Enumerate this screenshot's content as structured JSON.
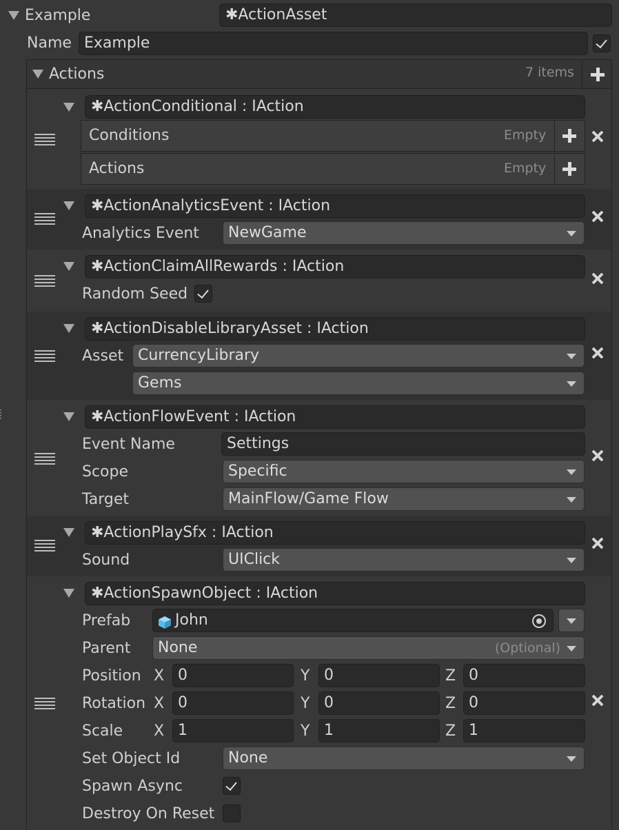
{
  "root": {
    "foldout_label": "Example",
    "asset_field": "✱ActionAsset",
    "name_label": "Name",
    "name_value": "Example",
    "name_checked": true
  },
  "actions_list": {
    "title": "Actions",
    "count_text": "7 items"
  },
  "items": {
    "conditional": {
      "header": "✱ActionConditional : IAction",
      "conditions_label": "Conditions",
      "conditions_status": "Empty",
      "actions_label": "Actions",
      "actions_status": "Empty"
    },
    "analytics": {
      "header": "✱ActionAnalyticsEvent : IAction",
      "event_label": "Analytics Event",
      "event_value": "NewGame"
    },
    "claim": {
      "header": "✱ActionClaimAllRewards : IAction",
      "seed_label": "Random Seed",
      "seed_checked": true
    },
    "disable": {
      "header": "✱ActionDisableLibraryAsset : IAction",
      "asset_label": "Asset",
      "library_value": "CurrencyLibrary",
      "item_value": "Gems"
    },
    "flow": {
      "header": "✱ActionFlowEvent : IAction",
      "event_name_label": "Event Name",
      "event_name_value": "Settings",
      "scope_label": "Scope",
      "scope_value": "Specific",
      "target_label": "Target",
      "target_value": "MainFlow/Game Flow"
    },
    "sfx": {
      "header": "✱ActionPlaySfx : IAction",
      "sound_label": "Sound",
      "sound_value": "UIClick"
    },
    "spawn": {
      "header": "✱ActionSpawnObject : IAction",
      "prefab_label": "Prefab",
      "prefab_value": "John",
      "parent_label": "Parent",
      "parent_value": "None",
      "parent_hint": "(Optional)",
      "position_label": "Position",
      "rotation_label": "Rotation",
      "scale_label": "Scale",
      "axis_x": "X",
      "axis_y": "Y",
      "axis_z": "Z",
      "position": [
        "0",
        "0",
        "0"
      ],
      "rotation": [
        "0",
        "0",
        "0"
      ],
      "scale": [
        "1",
        "1",
        "1"
      ],
      "object_id_label": "Set Object Id",
      "object_id_value": "None",
      "spawn_async_label": "Spawn Async",
      "spawn_async_checked": true,
      "destroy_label": "Destroy On Reset",
      "destroy_checked": false
    }
  },
  "colors": {
    "background": "#383838",
    "band_dark": "#313131",
    "field": "#2a2a2a",
    "dropdown": "#515151",
    "text": "#d2d2d2",
    "prefab_icon": "#6fc3ef"
  }
}
